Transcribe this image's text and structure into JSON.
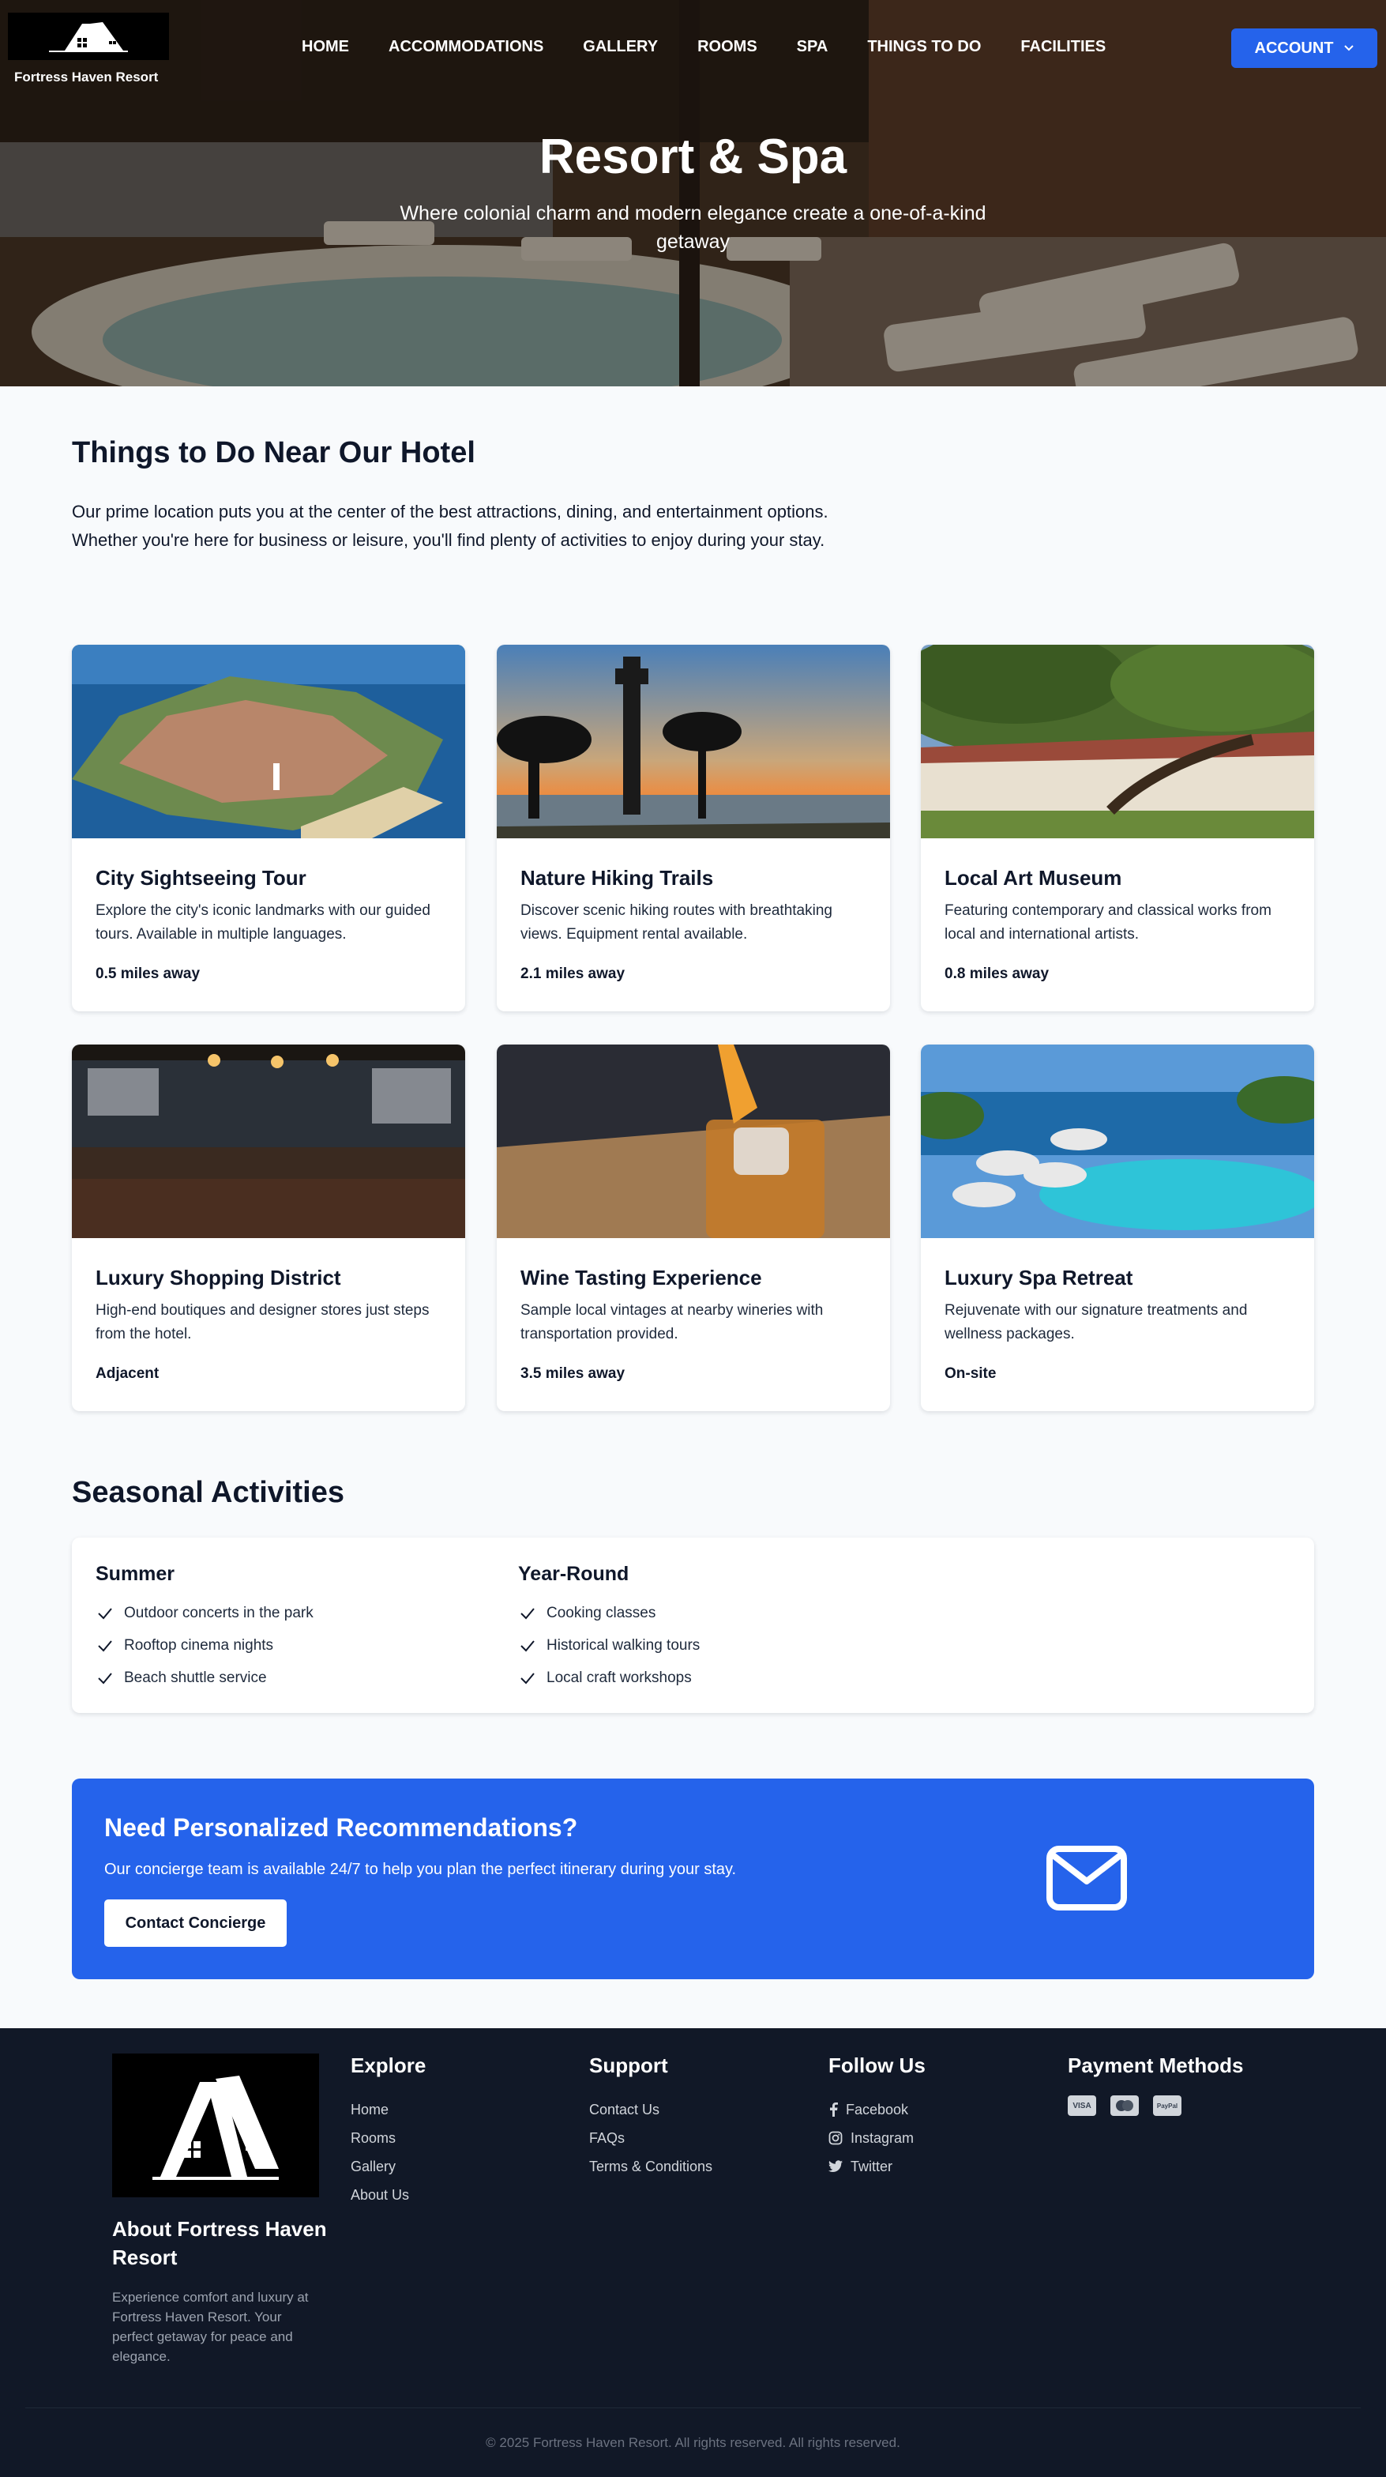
{
  "brand": {
    "name": "Fortress Haven Resort"
  },
  "nav": {
    "items": [
      {
        "label": "HOME"
      },
      {
        "label": "ACCOMMODATIONS"
      },
      {
        "label": "GALLERY"
      },
      {
        "label": "ROOMS"
      },
      {
        "label": "SPA"
      },
      {
        "label": "THINGS TO DO"
      },
      {
        "label": "FACILITIES"
      }
    ],
    "account_label": "ACCOUNT"
  },
  "hero": {
    "title": "Resort & Spa",
    "subtitle": "Where colonial charm and modern elegance create a one-of-a-kind getaway"
  },
  "things": {
    "title": "Things to Do Near Our Hotel",
    "intro": "Our prime location puts you at the center of the best attractions, dining, and entertainment options. Whether you're here for business or leisure, you'll find plenty of activities to enjoy during your stay.",
    "cards": [
      {
        "title": "City Sightseeing Tour",
        "desc": "Explore the city's iconic landmarks with our guided tours. Available in multiple languages.",
        "distance": "0.5 miles away"
      },
      {
        "title": "Nature Hiking Trails",
        "desc": "Discover scenic hiking routes with breathtaking views. Equipment rental available.",
        "distance": "2.1 miles away"
      },
      {
        "title": "Local Art Museum",
        "desc": "Featuring contemporary and classical works from local and international artists.",
        "distance": "0.8 miles away"
      },
      {
        "title": "Luxury Shopping District",
        "desc": "High-end boutiques and designer stores just steps from the hotel.",
        "distance": "Adjacent"
      },
      {
        "title": "Wine Tasting Experience",
        "desc": "Sample local vintages at nearby wineries with transportation provided.",
        "distance": "3.5 miles away"
      },
      {
        "title": "Luxury Spa Retreat",
        "desc": "Rejuvenate with our signature treatments and wellness packages.",
        "distance": "On-site"
      }
    ]
  },
  "seasonal": {
    "title": "Seasonal Activities",
    "summer": {
      "title": "Summer",
      "items": [
        "Outdoor concerts in the park",
        "Rooftop cinema nights",
        "Beach shuttle service"
      ]
    },
    "yearround": {
      "title": "Year-Round",
      "items": [
        "Cooking classes",
        "Historical walking tours",
        "Local craft workshops"
      ]
    }
  },
  "cta": {
    "title": "Need Personalized Recommendations?",
    "text": "Our concierge team is available 24/7 to help you plan the perfect itinerary during your stay.",
    "button": "Contact Concierge"
  },
  "footer": {
    "about_title": "About Fortress Haven Resort",
    "about_text": "Experience comfort and luxury at Fortress Haven Resort. Your perfect getaway for peace and elegance.",
    "explore": {
      "title": "Explore",
      "links": [
        "Home",
        "Rooms",
        "Gallery",
        "About Us"
      ]
    },
    "support": {
      "title": "Support",
      "links": [
        "Contact Us",
        "FAQs",
        "Terms & Conditions"
      ]
    },
    "follow": {
      "title": "Follow Us",
      "links": [
        "Facebook",
        "Instagram",
        "Twitter"
      ]
    },
    "payment": {
      "title": "Payment Methods",
      "methods": [
        "VISA",
        "MC",
        "PayPal"
      ]
    },
    "copyright": "© 2025 Fortress Haven Resort. All rights reserved. All rights reserved."
  },
  "colors": {
    "primary": "#2563eb",
    "footer_bg": "#111827",
    "page_bg": "#f8fafc"
  }
}
